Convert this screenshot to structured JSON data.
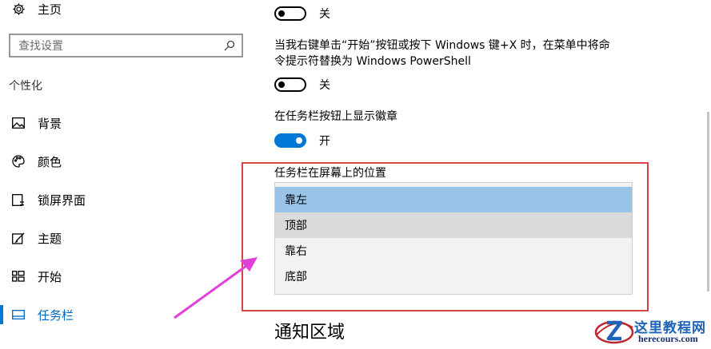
{
  "sidebar": {
    "home_label": "主页",
    "search_placeholder": "查找设置",
    "section_label": "个性化",
    "items": [
      {
        "label": "背景",
        "icon": "picture-icon"
      },
      {
        "label": "颜色",
        "icon": "palette-icon"
      },
      {
        "label": "锁屏界面",
        "icon": "lock-screen-icon"
      },
      {
        "label": "主题",
        "icon": "theme-icon"
      },
      {
        "label": "开始",
        "icon": "start-grid-icon"
      },
      {
        "label": "任务栏",
        "icon": "taskbar-icon",
        "active": true
      }
    ]
  },
  "content": {
    "toggle1": {
      "state": "关",
      "on": false
    },
    "powershell_text_line1": "当我右键单击“开始”按钮或按下 Windows 键+X 时，在菜单中将命",
    "powershell_text_line2": "令提示符替换为 Windows PowerShell",
    "toggle2": {
      "state": "关",
      "on": false
    },
    "badges_label": "在任务栏按钮上显示徽章",
    "toggle3": {
      "state": "开",
      "on": true
    },
    "position_label": "任务栏在屏幕上的位置",
    "position_options": [
      "靠左",
      "顶部",
      "靠右",
      "底部"
    ],
    "position_selected": "靠左",
    "notification_heading": "通知区域"
  },
  "watermark": {
    "title": "这里教程网",
    "url": "herecours.com"
  },
  "colors": {
    "accent": "#0078d7",
    "selected_option": "#99c4e8",
    "annotation_red": "#d64545",
    "annotation_arrow": "#e040d8"
  }
}
